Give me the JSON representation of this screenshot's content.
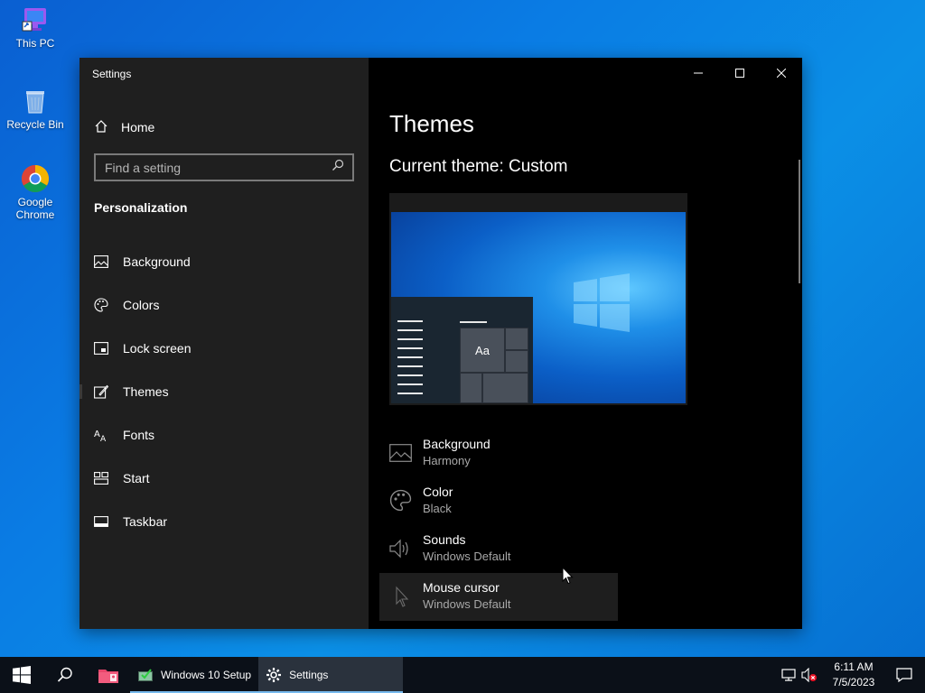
{
  "desktop": {
    "icons": [
      {
        "label": "This PC",
        "icon": "this-pc-icon"
      },
      {
        "label": "Recycle Bin",
        "icon": "recycle-bin-icon"
      },
      {
        "label": "Google Chrome",
        "icon": "chrome-icon"
      }
    ]
  },
  "window": {
    "title": "Settings",
    "controls": [
      "minimize",
      "maximize",
      "close"
    ]
  },
  "nav": {
    "home_label": "Home",
    "search_placeholder": "Find a setting",
    "section_title": "Personalization",
    "items": [
      {
        "label": "Background",
        "icon": "background-icon"
      },
      {
        "label": "Colors",
        "icon": "palette-icon"
      },
      {
        "label": "Lock screen",
        "icon": "lock-screen-icon"
      },
      {
        "label": "Themes",
        "icon": "themes-icon",
        "selected": true
      },
      {
        "label": "Fonts",
        "icon": "fonts-icon"
      },
      {
        "label": "Start",
        "icon": "start-icon"
      },
      {
        "label": "Taskbar",
        "icon": "taskbar-icon"
      }
    ]
  },
  "content": {
    "title": "Themes",
    "current_theme": "Current theme: Custom",
    "preview": {
      "sample_text": "Aa"
    },
    "theme_items": [
      {
        "name": "Background",
        "value": "Harmony",
        "icon": "image-icon"
      },
      {
        "name": "Color",
        "value": "Black",
        "icon": "palette-icon"
      },
      {
        "name": "Sounds",
        "value": "Windows Default",
        "icon": "speaker-icon"
      },
      {
        "name": "Mouse cursor",
        "value": "Windows Default",
        "icon": "mouse-pointer-icon",
        "hover": true
      }
    ]
  },
  "taskbar": {
    "apps": [
      {
        "label": "Windows 10 Setup",
        "icon": "setup-icon",
        "active": false
      },
      {
        "label": "Settings",
        "icon": "gear-icon",
        "active": true
      }
    ],
    "clock": {
      "time": "6:11 AM",
      "date": "7/5/2023"
    }
  },
  "colors": {
    "accent": "#76b9ed",
    "nav_bg": "#1f1f1f",
    "content_bg": "#000000",
    "desktop": "#0a7ce4"
  }
}
